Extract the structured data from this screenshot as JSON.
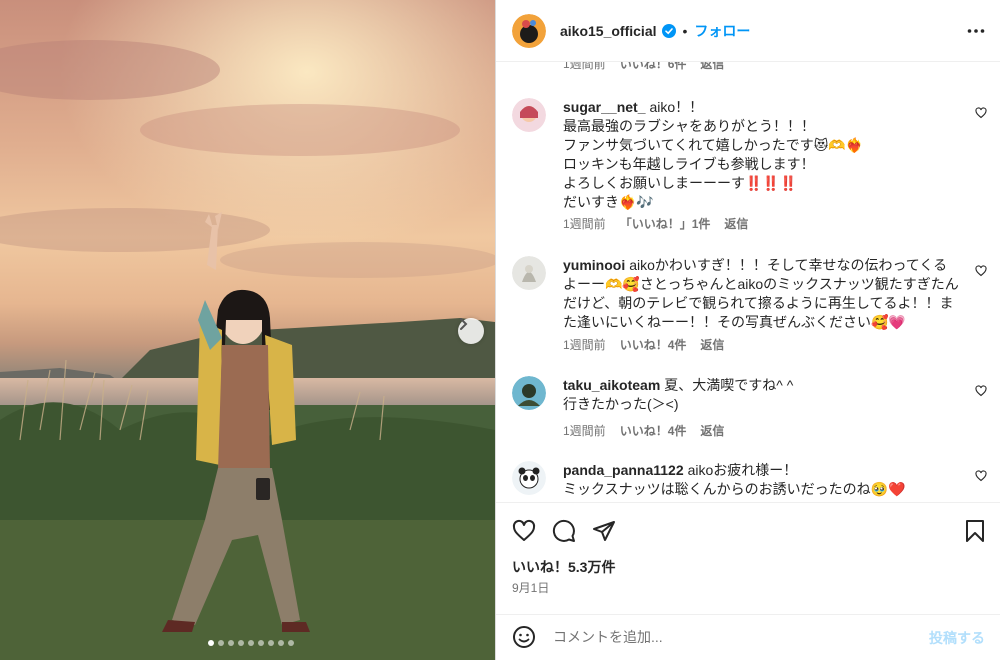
{
  "post": {
    "author": "aiko15_official",
    "follow_label": "フォロー",
    "separator": "•",
    "photo_alt": "Person standing in a field at sunset making a peace sign, sea and hills behind",
    "carousel_count": 9,
    "carousel_index": 0
  },
  "comments": {
    "top_meta": {
      "time": "1週間前",
      "likes": "いいね！6件",
      "reply": "返信"
    },
    "items": [
      {
        "user": "sugar__net_",
        "text": "aiko！！\n最高最強のラブシャをありがとう！！！\nファンサ気づいてくれて嬉しかったです😻🫶❤️‍🔥\nロッキンも年越しライブも参戦します！\nよろしくお願いしまーーーす‼️‼️‼️\nだいすき❤️‍🔥🎶",
        "time": "1週間前",
        "likes": "「いいね！」1件",
        "reply": "返信"
      },
      {
        "user": "yuminooi",
        "text": "aikoかわいすぎ！！！そして幸せなの伝わってくるよーー🫶🥰さとっちゃんとaikoのミックスナッツ観たすぎたんだけど、朝のテレビで観られて擦るように再生してるよ！！また逢いにいくねーー！！その写真ぜんぶください🥰💗",
        "time": "1週間前",
        "likes": "いいね！4件",
        "reply": "返信"
      },
      {
        "user": "taku_aikoteam",
        "text": "夏、大満喫ですね^ ^\n行きたかった(＞<)",
        "time": "1週間前",
        "likes": "いいね！4件",
        "reply": "返信"
      },
      {
        "user": "panda_panna1122",
        "text": "aikoお疲れ様ー！\nミックスナッツは聡くんからのお誘いだったのね🥹❤️",
        "time": "",
        "likes": "",
        "reply": ""
      }
    ]
  },
  "actions": {
    "likes_text": "いいね！5.3万件",
    "date": "9月1日"
  },
  "composer": {
    "placeholder": "コメントを追加...",
    "post_label": "投稿する"
  },
  "colors": {
    "accent": "#0095f6",
    "post_disabled": "#b2dffc",
    "meta": "#737373"
  }
}
